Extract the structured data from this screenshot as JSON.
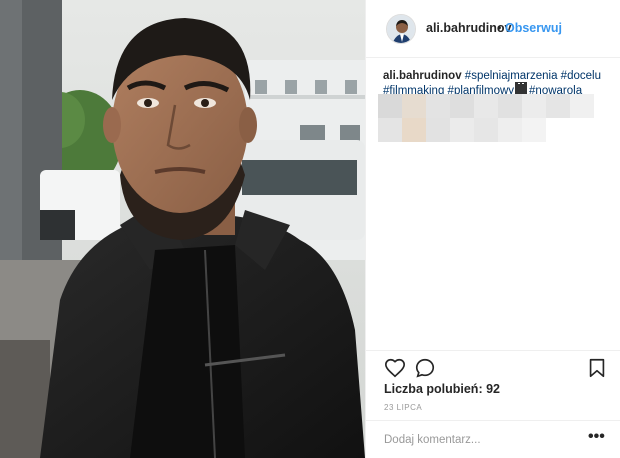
{
  "post": {
    "username": "ali.bahrudinov",
    "separator": "•",
    "follow_label": "Obserwuj",
    "caption": {
      "username": "ali.bahrudinov",
      "line1_tags": "#spelniajmarzenia #docelu",
      "line2_tags_a": "#filmmaking #planfilmowy",
      "line2_tags_b": "#nowarola"
    },
    "likes_label": "Liczba polubień: 92",
    "date": "23 LIPCA",
    "comment_placeholder": "Dodaj komentarz...",
    "more_label": "•••"
  },
  "icons": {
    "like": "heart-outline-icon",
    "comment": "speech-bubble-icon",
    "save": "bookmark-icon",
    "caption_emoji": "clapper-board-icon"
  },
  "colors": {
    "link": "#3897f0",
    "hashtag": "#003569",
    "text": "#262626",
    "muted": "#999999"
  }
}
